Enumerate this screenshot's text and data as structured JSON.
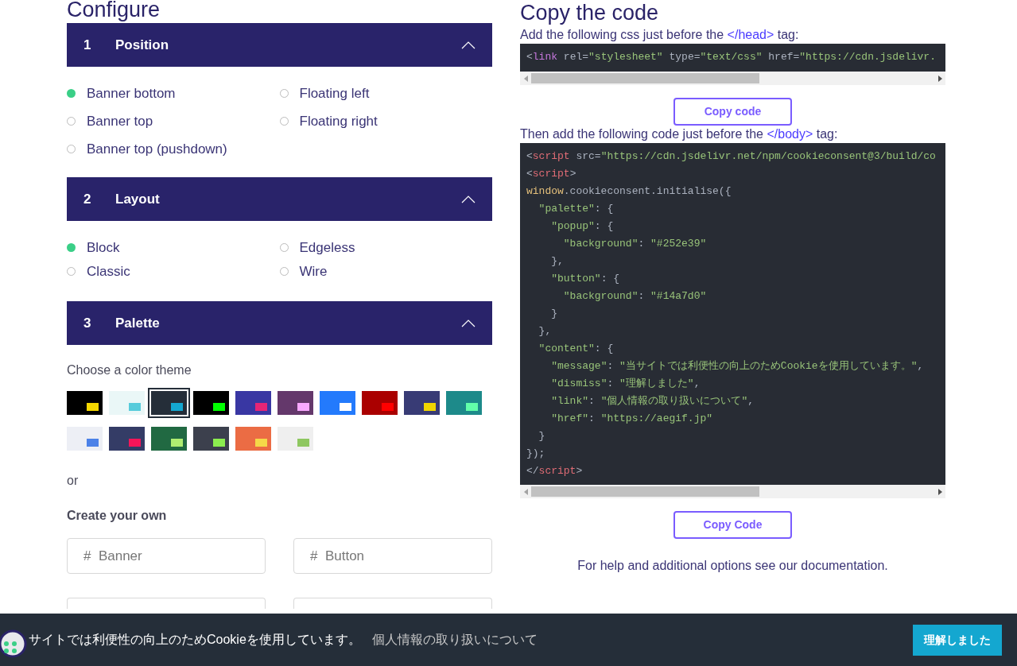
{
  "configure": {
    "title": "Configure",
    "sections": [
      {
        "number": "1",
        "title": "Position",
        "expanded": true,
        "kind": "radio",
        "options": [
          {
            "label": "Banner bottom",
            "selected": true
          },
          {
            "label": "Floating left",
            "selected": false
          },
          {
            "label": "Banner top",
            "selected": false
          },
          {
            "label": "Floating right",
            "selected": false
          },
          {
            "label": "Banner top (pushdown)",
            "selected": false
          }
        ]
      },
      {
        "number": "2",
        "title": "Layout",
        "expanded": true,
        "kind": "radio",
        "options": [
          {
            "label": "Block",
            "selected": true
          },
          {
            "label": "Edgeless",
            "selected": false
          },
          {
            "label": "Classic",
            "selected": false
          },
          {
            "label": "Wire",
            "selected": false
          }
        ]
      },
      {
        "number": "3",
        "title": "Palette",
        "expanded": true,
        "kind": "palette",
        "prompt": "Choose a color theme",
        "themes": [
          {
            "color": "#000000",
            "accent": {
              "color": "#f5d800"
            },
            "selected": false
          },
          {
            "color": "#eaf7f7",
            "accent": {
              "color": "#56cbdb"
            },
            "selected": false
          },
          {
            "color": "#252e39",
            "accent": {
              "color": "#14a7d0"
            },
            "selected": true
          },
          {
            "color": "#000000",
            "accent": {
              "color": "#00ff00"
            },
            "selected": false
          },
          {
            "color": "#3937a3",
            "accent": {
              "color": "#e62576"
            },
            "selected": false
          },
          {
            "color": "#64386b",
            "accent": {
              "color": "#f8a8ff"
            },
            "selected": false
          },
          {
            "color": "#237afc",
            "accent": {
              "color": "#ffffff"
            },
            "selected": false
          },
          {
            "color": "#aa0000",
            "accent": {
              "color": "#ff0000"
            },
            "selected": false
          },
          {
            "color": "#383b75",
            "accent": {
              "color": "#f1d600"
            },
            "selected": false
          },
          {
            "color": "#1d8a8a",
            "accent": {
              "color": "#62ffaa"
            },
            "selected": false
          },
          {
            "color": "#edeff5",
            "accent": {
              "color": "#4b81e8"
            },
            "selected": false
          },
          {
            "color": "#343c66",
            "accent": {
              "color": "#f71559"
            },
            "selected": false
          },
          {
            "color": "#216942",
            "accent": {
              "color": "#afed71"
            },
            "selected": false
          },
          {
            "color": "#3c404d",
            "accent": {
              "color": "#8bed4f"
            },
            "selected": false
          },
          {
            "color": "#eb6c44",
            "accent": {
              "color": "#f5d948"
            },
            "selected": false
          },
          {
            "color": "#efefef",
            "accent": {
              "color": "#8ec760"
            },
            "selected": false
          }
        ],
        "or_text": "or",
        "custom_heading": "Create your own",
        "fields": [
          {
            "kind": "field",
            "placeholder": "#  Banner"
          },
          {
            "kind": "field",
            "placeholder": "#  Button"
          },
          {
            "kind": "cut_field"
          },
          {
            "kind": "cut_field"
          }
        ]
      }
    ]
  },
  "copy": {
    "title": "Copy the code",
    "blocks": [
      {
        "instruction": {
          "before": "Add the following css just before the",
          "tag": "</head>",
          "after": "tag:"
        },
        "lines": [
          "<link rel=\"stylesheet\" type=\"text/css\" href=\"https://cdn.jsdelivr."
        ],
        "button": "Copy code"
      },
      {
        "instruction": {
          "before": "Then add the following code just before the",
          "tag": "</body>",
          "after": "tag:"
        },
        "lines": [
          "<script src=\"https://cdn.jsdelivr.net/npm/cookieconsent@3/build/co",
          "<script>",
          "window.cookieconsent.initialise({",
          "  \"palette\": {",
          "    \"popup\": {",
          "      \"background\": \"#252e39\"",
          "    },",
          "    \"button\": {",
          "      \"background\": \"#14a7d0\"",
          "    }",
          "  },",
          "  \"content\": {",
          "    \"message\": \"当サイトでは利便性の向上のためCookieを使用しています。\",",
          "    \"dismiss\": \"理解しました\",",
          "    \"link\": \"個人情報の取り扱いについて\",",
          "    \"href\": \"https://aegif.jp\"",
          "  }",
          "});",
          "</script>"
        ],
        "button": "Copy Code"
      }
    ],
    "help": "For help and additional options see our documentation."
  },
  "cookie_banner": {
    "message": "サイトでは利便性の向上のためCookieを使用しています。",
    "link": "個人情報の取り扱いについて",
    "button": "理解しました"
  }
}
